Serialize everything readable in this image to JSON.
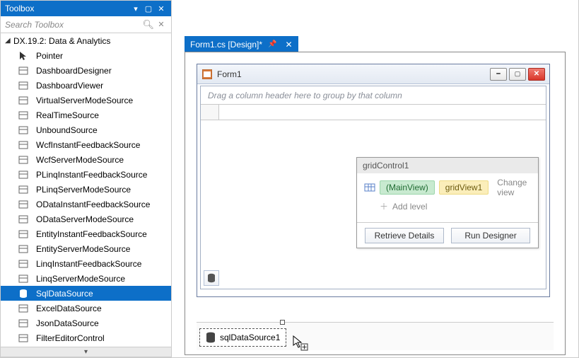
{
  "toolbox": {
    "title": "Toolbox",
    "search_placeholder": "Search Toolbox",
    "category": "DX.19.2: Data & Analytics",
    "items": [
      {
        "label": "Pointer"
      },
      {
        "label": "DashboardDesigner"
      },
      {
        "label": "DashboardViewer"
      },
      {
        "label": "VirtualServerModeSource"
      },
      {
        "label": "RealTimeSource"
      },
      {
        "label": "UnboundSource"
      },
      {
        "label": "WcfInstantFeedbackSource"
      },
      {
        "label": "WcfServerModeSource"
      },
      {
        "label": "PLinqInstantFeedbackSource"
      },
      {
        "label": "PLinqServerModeSource"
      },
      {
        "label": "ODataInstantFeedbackSource"
      },
      {
        "label": "ODataServerModeSource"
      },
      {
        "label": "EntityInstantFeedbackSource"
      },
      {
        "label": "EntityServerModeSource"
      },
      {
        "label": "LinqInstantFeedbackSource"
      },
      {
        "label": "LinqServerModeSource"
      },
      {
        "label": "SqlDataSource",
        "selected": true
      },
      {
        "label": "ExcelDataSource"
      },
      {
        "label": "JsonDataSource"
      },
      {
        "label": "FilterEditorControl"
      }
    ]
  },
  "document": {
    "tab_label": "Form1.cs [Design]*"
  },
  "form": {
    "title": "Form1",
    "group_hint": "Drag a column header here to group by that column"
  },
  "popup": {
    "header": "gridControl1",
    "main_view": "(MainView)",
    "grid_view": "gridView1",
    "change_view": "Change view",
    "add_level": "Add level",
    "retrieve": "Retrieve Details",
    "run_designer": "Run Designer"
  },
  "component": {
    "label": "sqlDataSource1"
  }
}
